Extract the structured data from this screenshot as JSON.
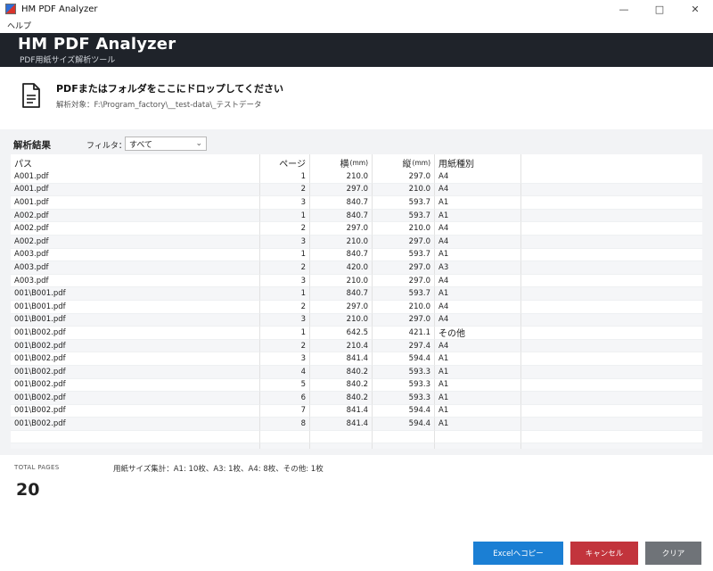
{
  "window": {
    "title": "HM PDF Analyzer"
  },
  "menu": {
    "help": "ヘルプ"
  },
  "banner": {
    "app_name": "HM PDF Analyzer",
    "subtitle": "PDF用紙サイズ解析ツール"
  },
  "dropzone": {
    "title": "PDFまたはフォルダをここにドロップしてください",
    "target": "解析対象：F:\\Program_factory\\__test-data\\_テストデータ"
  },
  "results": {
    "label": "解析結果",
    "filter_label": "フィルタ：",
    "filter_value": "すべて"
  },
  "table": {
    "headers": {
      "path": "パス",
      "page": "ページ",
      "width": "横",
      "height": "縦",
      "unit": "(mm)",
      "type": "用紙種別"
    },
    "rows": [
      {
        "path": "A001.pdf",
        "page": "1",
        "w": "210.0",
        "h": "297.0",
        "type": "A4"
      },
      {
        "path": "A001.pdf",
        "page": "2",
        "w": "297.0",
        "h": "210.0",
        "type": "A4"
      },
      {
        "path": "A001.pdf",
        "page": "3",
        "w": "840.7",
        "h": "593.7",
        "type": "A1"
      },
      {
        "path": "A002.pdf",
        "page": "1",
        "w": "840.7",
        "h": "593.7",
        "type": "A1"
      },
      {
        "path": "A002.pdf",
        "page": "2",
        "w": "297.0",
        "h": "210.0",
        "type": "A4"
      },
      {
        "path": "A002.pdf",
        "page": "3",
        "w": "210.0",
        "h": "297.0",
        "type": "A4"
      },
      {
        "path": "A003.pdf",
        "page": "1",
        "w": "840.7",
        "h": "593.7",
        "type": "A1"
      },
      {
        "path": "A003.pdf",
        "page": "2",
        "w": "420.0",
        "h": "297.0",
        "type": "A3"
      },
      {
        "path": "A003.pdf",
        "page": "3",
        "w": "210.0",
        "h": "297.0",
        "type": "A4"
      },
      {
        "path": "001\\B001.pdf",
        "page": "1",
        "w": "840.7",
        "h": "593.7",
        "type": "A1"
      },
      {
        "path": "001\\B001.pdf",
        "page": "2",
        "w": "297.0",
        "h": "210.0",
        "type": "A4"
      },
      {
        "path": "001\\B001.pdf",
        "page": "3",
        "w": "210.0",
        "h": "297.0",
        "type": "A4"
      },
      {
        "path": "001\\B002.pdf",
        "page": "1",
        "w": "642.5",
        "h": "421.1",
        "type": "その他"
      },
      {
        "path": "001\\B002.pdf",
        "page": "2",
        "w": "210.4",
        "h": "297.4",
        "type": "A4"
      },
      {
        "path": "001\\B002.pdf",
        "page": "3",
        "w": "841.4",
        "h": "594.4",
        "type": "A1"
      },
      {
        "path": "001\\B002.pdf",
        "page": "4",
        "w": "840.2",
        "h": "593.3",
        "type": "A1"
      },
      {
        "path": "001\\B002.pdf",
        "page": "5",
        "w": "840.2",
        "h": "593.3",
        "type": "A1"
      },
      {
        "path": "001\\B002.pdf",
        "page": "6",
        "w": "840.2",
        "h": "593.3",
        "type": "A1"
      },
      {
        "path": "001\\B002.pdf",
        "page": "7",
        "w": "841.4",
        "h": "594.4",
        "type": "A1"
      },
      {
        "path": "001\\B002.pdf",
        "page": "8",
        "w": "841.4",
        "h": "594.4",
        "type": "A1"
      }
    ]
  },
  "footer": {
    "total_label": "TOTAL PAGES",
    "total_value": "20",
    "summary": "用紙サイズ集計：A1: 10枚、A3: 1枚、A4: 8枚、その他: 1枚"
  },
  "buttons": {
    "excel": "Excelへコピー",
    "cancel": "キャンセル",
    "clear": "クリア"
  },
  "colors": {
    "banner": "#1f232a",
    "excel": "#1b7fd4",
    "cancel": "#c2343c",
    "clear": "#6f7378"
  }
}
